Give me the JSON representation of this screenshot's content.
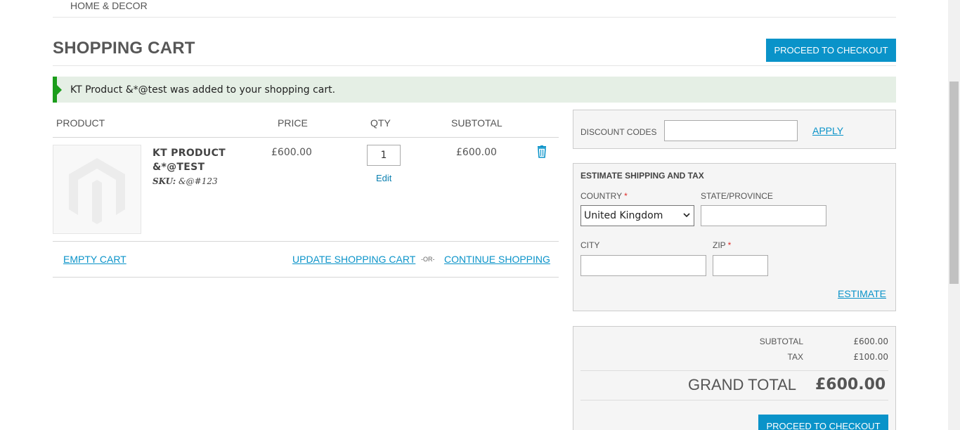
{
  "nav": {
    "top_item": "HOME & DECOR"
  },
  "page": {
    "title": "SHOPPING CART",
    "proceed_top": "PROCEED TO CHECKOUT"
  },
  "message": {
    "text": "KT Product &*@test was added to your shopping cart."
  },
  "cart": {
    "columns": {
      "product": "PRODUCT",
      "price": "PRICE",
      "qty": "QTY",
      "subtotal": "SUBTOTAL"
    },
    "item": {
      "name": "KT PRODUCT &*@TEST",
      "sku_label": "SKU:",
      "sku_value": "&@#123",
      "price": "£600.00",
      "qty": "1",
      "edit": "Edit",
      "subtotal": "£600.00"
    },
    "actions": {
      "empty": "EMPTY CART",
      "update": "UPDATE SHOPPING CART",
      "or": "-OR-",
      "continue": "CONTINUE SHOPPING"
    }
  },
  "discount": {
    "label": "DISCOUNT CODES",
    "apply": "APPLY",
    "value": ""
  },
  "shipping": {
    "title": "ESTIMATE SHIPPING AND TAX",
    "country_label": "COUNTRY",
    "country_value": "United Kingdom",
    "state_label": "STATE/PROVINCE",
    "city_label": "CITY",
    "zip_label": "ZIP",
    "required_mark": "*",
    "estimate": "ESTIMATE"
  },
  "totals": {
    "subtotal_label": "SUBTOTAL",
    "subtotal_value": "£600.00",
    "tax_label": "TAX",
    "tax_value": "£100.00",
    "grand_label": "GRAND TOTAL",
    "grand_value": "£600.00",
    "proceed_bottom": "PROCEED TO CHECKOUT"
  },
  "colors": {
    "accent": "#0a93c9",
    "success": "#1b9d1b",
    "message_bg": "#e5efe5",
    "required": "#e02b27"
  }
}
